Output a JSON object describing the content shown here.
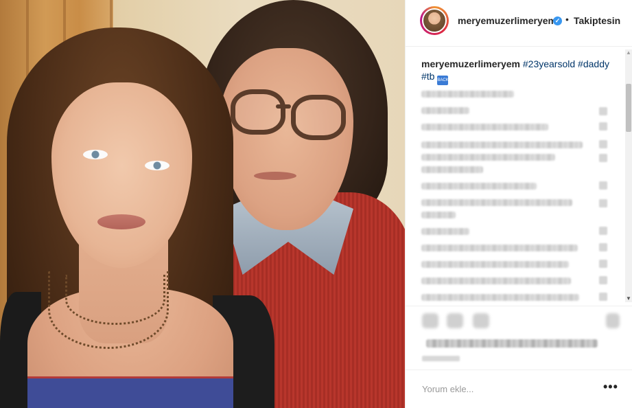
{
  "post": {
    "username": "meryemuzerlimeryem",
    "follow_label": "Takiptesin",
    "separator": "•",
    "verified_mark": "✓",
    "caption": {
      "username": "meryemuzerlimeryem",
      "tags": [
        "#23yearsold",
        "#daddy",
        "#tb"
      ],
      "emoji": "🔙"
    },
    "comment_placeholder": "Yorum ekle...",
    "more_label": "•••"
  },
  "icons": {
    "like": "heart-icon",
    "comment": "comment-icon",
    "share": "share-icon",
    "save": "bookmark-icon",
    "verified": "verified-badge-icon",
    "options": "more-options-icon"
  },
  "colors": {
    "hashtag": "#003569",
    "verified": "#3897f0",
    "placeholder": "#999999"
  }
}
